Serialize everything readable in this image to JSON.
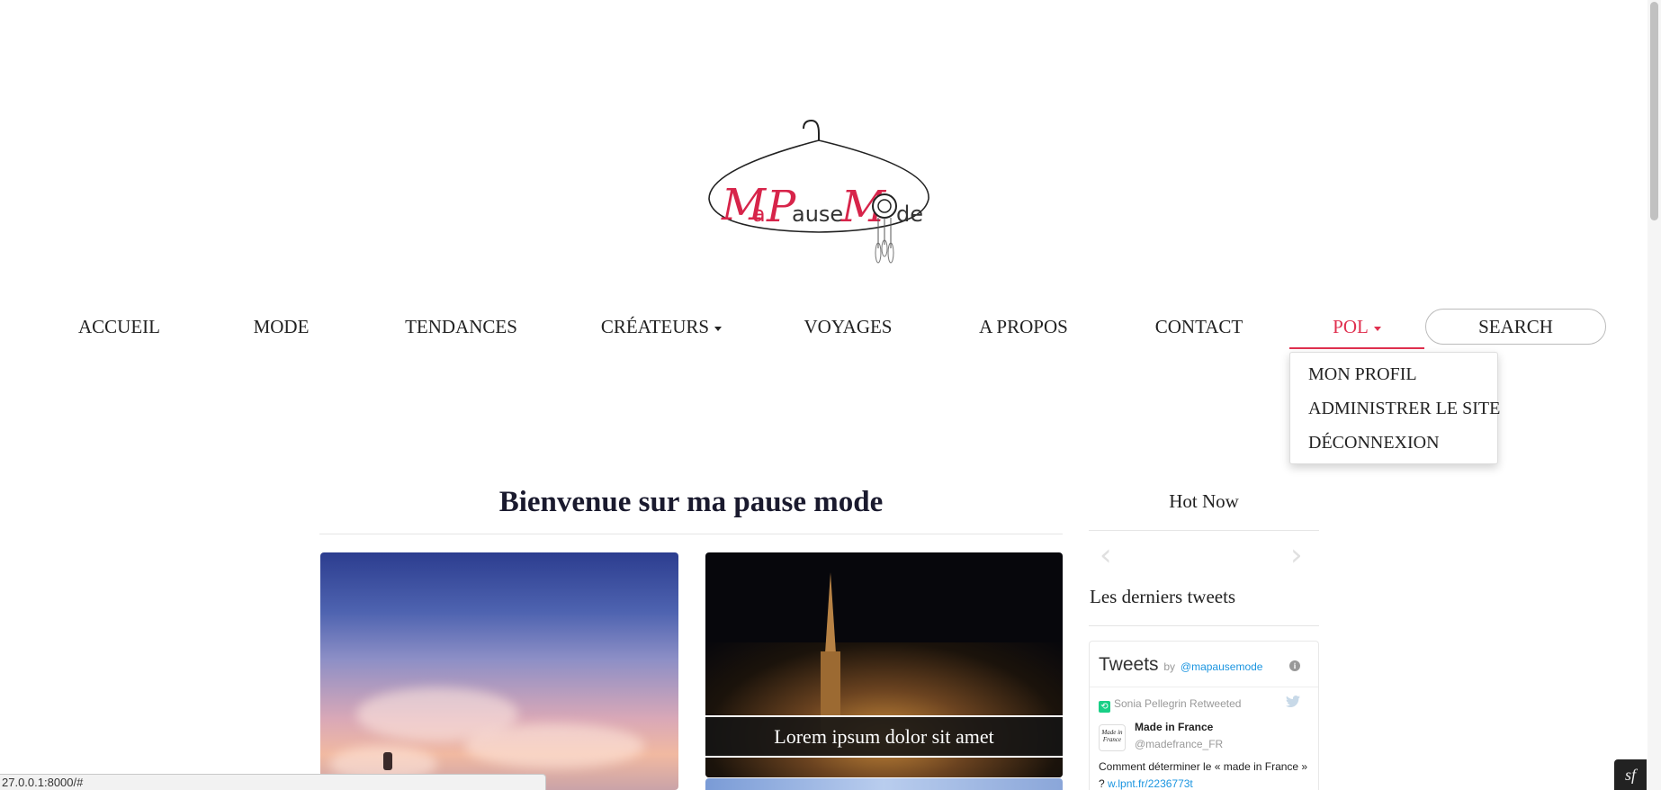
{
  "logo": {
    "alt_text": "MaPauseMode"
  },
  "nav": {
    "items": [
      {
        "label": "ACCUEIL"
      },
      {
        "label": "MODE"
      },
      {
        "label": "TENDANCES"
      },
      {
        "label": "CRÉATEURS",
        "has_dropdown": true
      },
      {
        "label": "VOYAGES"
      },
      {
        "label": "A PROPOS"
      },
      {
        "label": "CONTACT"
      },
      {
        "label": "POL",
        "has_dropdown": true,
        "active": true
      }
    ],
    "search_label": "SEARCH",
    "active_color": "#e0304f"
  },
  "user_menu": {
    "items": [
      {
        "label": "MON PROFIL"
      },
      {
        "label": "ADMINISTRER LE SITE"
      },
      {
        "label": "DÉCONNEXION"
      }
    ]
  },
  "main": {
    "title": "Bienvenue sur ma pause mode",
    "cards": [
      {
        "caption": ""
      },
      {
        "caption": "Lorem ipsum dolor sit amet"
      }
    ]
  },
  "sidebar": {
    "hot_title": "Hot Now",
    "tweets_heading": "Les derniers tweets",
    "widget": {
      "title": "Tweets",
      "by": "by",
      "handle": "@mapausemode",
      "retweet_text": "Sonia Pellegrin Retweeted",
      "tweet": {
        "author": "Made in France",
        "username": "@madefrance_FR",
        "avatar_text": "Made in France",
        "text": "Comment déterminer le « made in France » ?",
        "link": "w.lpnt.fr/2236773t"
      }
    }
  },
  "status_bar": {
    "url": "27.0.0.1:8000/#"
  },
  "icons": {
    "prev": "chevron-left-icon",
    "next": "chevron-right-icon",
    "twitter": "twitter-bird-icon",
    "info": "info-icon",
    "retweet": "retweet-icon",
    "symfony": "symfony-icon"
  }
}
